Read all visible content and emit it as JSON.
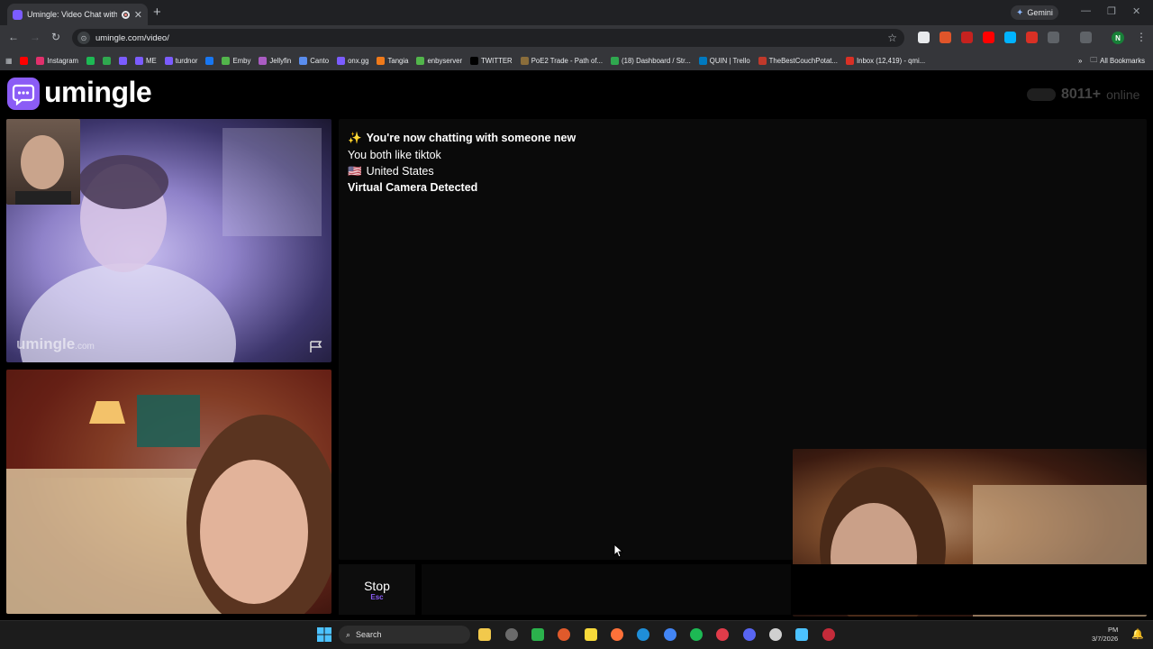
{
  "browser": {
    "tab_title": "Umingle: Video Chat with S",
    "new_tab": "+",
    "gemini_label": "Gemini",
    "url": "umingle.com/video/",
    "profile_initial": "N",
    "bookmarks": [
      {
        "label": "",
        "color": "#ff0000"
      },
      {
        "label": "Instagram",
        "color": "#e1306c"
      },
      {
        "label": "",
        "color": "#1db954"
      },
      {
        "label": "",
        "color": "#2fa84f"
      },
      {
        "label": "",
        "color": "#7b5cff"
      },
      {
        "label": "ME",
        "color": "#7b5cff"
      },
      {
        "label": "turdnor",
        "color": "#7b5cff"
      },
      {
        "label": "",
        "color": "#1877f2"
      },
      {
        "label": "Emby",
        "color": "#52b54b"
      },
      {
        "label": "Jellyfin",
        "color": "#aa5cc3"
      },
      {
        "label": "Canto",
        "color": "#5a8dee"
      },
      {
        "label": "onx.gg",
        "color": "#7b5cff"
      },
      {
        "label": "Tangia",
        "color": "#f07a1a"
      },
      {
        "label": "enbyserver",
        "color": "#52b54b"
      },
      {
        "label": "TWITTER",
        "color": "#000000"
      },
      {
        "label": "PoE2 Trade - Path of...",
        "color": "#8a6d3b"
      },
      {
        "label": "(18) Dashboard / Str...",
        "color": "#2fa84f"
      },
      {
        "label": "QUIN | Trello",
        "color": "#0079bf"
      },
      {
        "label": "TheBestCouchPotat...",
        "color": "#c0392b"
      },
      {
        "label": "Inbox (12,419) - qmi...",
        "color": "#d93025"
      }
    ],
    "all_bookmarks": "All Bookmarks"
  },
  "site": {
    "logo": "umingle",
    "online_count": "8011+",
    "online_label": "online",
    "watermark": "umingle",
    "watermark_suffix": ".com"
  },
  "chat": {
    "messages": [
      {
        "icon": "✨",
        "text": "You're now chatting with someone new",
        "bold": true
      },
      {
        "icon": "",
        "text": "You both like tiktok",
        "bold": false
      },
      {
        "icon": "🇺🇸",
        "text": "United States",
        "bold": false
      },
      {
        "icon": "",
        "text": "Virtual Camera Detected",
        "bold": true
      }
    ],
    "stop_label": "Stop",
    "stop_key": "Esc"
  },
  "taskbar": {
    "search_placeholder": "Search",
    "time": "PM",
    "date": "3/7/2026"
  },
  "colors": {
    "accent": "#8b5cf6",
    "page_bg": "#000000"
  }
}
